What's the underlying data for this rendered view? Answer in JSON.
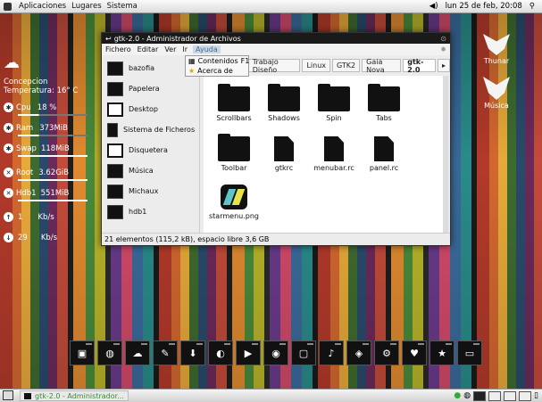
{
  "topbar": {
    "menus": [
      "Aplicaciones",
      "Lugares",
      "Sistema"
    ],
    "clock": "lun 25 de feb, 20:08"
  },
  "conky": {
    "location": "Concepcion",
    "temperature": "Temperatura: 16° C",
    "cpu_label": "Cpu",
    "cpu_value": "18 %",
    "ram_label": "Ram",
    "ram_value": "373MiB",
    "swap_label": "Swap",
    "swap_value": "118MiB",
    "root_label": "Root",
    "root_value": "3.62GiB",
    "hdb_label": "Hdb1",
    "hdb_value": "551MiB",
    "up_value": "1",
    "up_unit": "Kb/s",
    "down_value": "29",
    "down_unit": "Kb/s"
  },
  "desktop_icons": [
    {
      "label": "Thunar",
      "icon": "thunar-icon"
    },
    {
      "label": "Música",
      "icon": "music-icon"
    }
  ],
  "window": {
    "title": "gtk-2.0 - Administrador de Archivos",
    "menus": [
      "Fichero",
      "Editar",
      "Ver",
      "Ir",
      "Ayuda"
    ],
    "help_menu": [
      {
        "label": "Contenidos",
        "shortcut": "F1"
      },
      {
        "label": "Acerca de",
        "shortcut": ""
      }
    ],
    "path_buttons": [
      "x",
      "Trabajo Diseño",
      "Linux",
      "GTK2",
      "Gaia Nova",
      "gtk-2.0"
    ],
    "path_more": "▸",
    "sidebar": [
      "bazofia",
      "Papelera",
      "Desktop",
      "Sistema de Ficheros",
      "Disquetera",
      "Música",
      "Michaux",
      "hdb1"
    ],
    "files": [
      {
        "name": "Scrollbars",
        "kind": "folder"
      },
      {
        "name": "Shadows",
        "kind": "folder"
      },
      {
        "name": "Spin",
        "kind": "folder"
      },
      {
        "name": "Tabs",
        "kind": "folder"
      },
      {
        "name": "Toolbar",
        "kind": "folder"
      },
      {
        "name": "gtkrc",
        "kind": "doc"
      },
      {
        "name": "menubar.rc",
        "kind": "doc"
      },
      {
        "name": "panel.rc",
        "kind": "doc"
      },
      {
        "name": "starmenu.png",
        "kind": "image"
      }
    ],
    "status": "21 elementos (115,2 kB), espacio libre 3,6 GB"
  },
  "taskbar": {
    "task": "gtk-2.0 - Administrador..."
  },
  "dock_count": 15
}
